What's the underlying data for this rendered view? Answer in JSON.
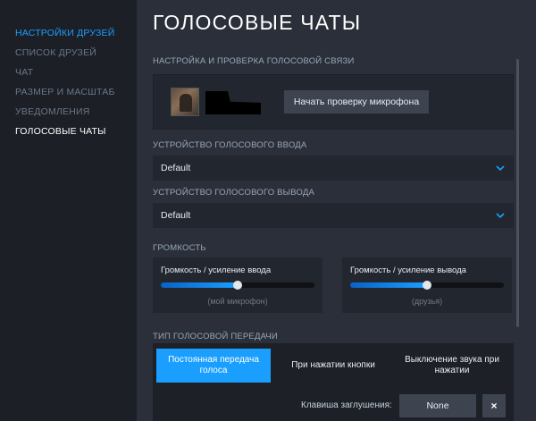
{
  "sidebar": {
    "items": [
      {
        "label": "НАСТРОЙКИ ДРУЗЕЙ"
      },
      {
        "label": "СПИСОК ДРУЗЕЙ"
      },
      {
        "label": "ЧАТ"
      },
      {
        "label": "РАЗМЕР И МАСШТАБ"
      },
      {
        "label": "УВЕДОМЛЕНИЯ"
      },
      {
        "label": "ГОЛОСОВЫЕ ЧАТЫ"
      }
    ]
  },
  "main": {
    "title": "ГОЛОСОВЫЕ ЧАТЫ",
    "mic_test": {
      "section_label": "НАСТРОЙКА И ПРОВЕРКА ГОЛОСОВОЙ СВЯЗИ",
      "button_label": "Начать проверку микрофона"
    },
    "input_device": {
      "label": "УСТРОЙСТВО ГОЛОСОВОГО ВВОДА",
      "value": "Default"
    },
    "output_device": {
      "label": "УСТРОЙСТВО ГОЛОСОВОГО ВЫВОДА",
      "value": "Default"
    },
    "volume": {
      "label": "ГРОМКОСТЬ",
      "input": {
        "title": "Громкость / усиление ввода",
        "sub": "(мой микрофон)",
        "level": 0.5
      },
      "output": {
        "title": "Громкость / усиление вывода",
        "sub": "(друзья)",
        "level": 0.5
      }
    },
    "transmission": {
      "label": "ТИП ГОЛОСОВОЙ ПЕРЕДАЧИ",
      "options": [
        {
          "label": "Постоянная передача голоса",
          "selected": true
        },
        {
          "label": "При нажатии кнопки",
          "selected": false
        },
        {
          "label": "Выключение звука при нажатии",
          "selected": false
        }
      ],
      "mute_key_label": "Клавиша заглушения:",
      "mute_key_value": "None",
      "clear_label": "×"
    }
  },
  "colors": {
    "accent": "#1a9fff",
    "background": "#2a2f3a",
    "sidebar": "#1c1f26"
  }
}
